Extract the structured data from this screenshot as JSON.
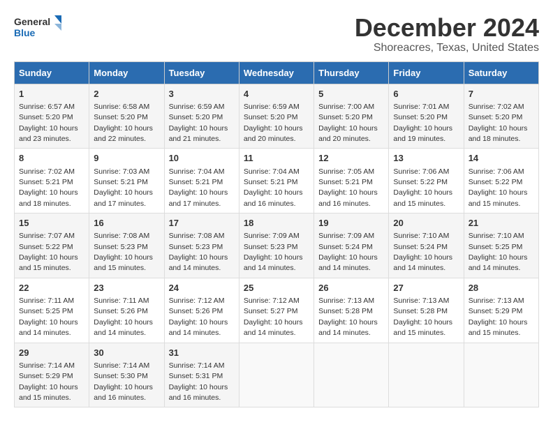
{
  "header": {
    "logo_line1": "General",
    "logo_line2": "Blue",
    "month": "December 2024",
    "location": "Shoreacres, Texas, United States"
  },
  "weekdays": [
    "Sunday",
    "Monday",
    "Tuesday",
    "Wednesday",
    "Thursday",
    "Friday",
    "Saturday"
  ],
  "weeks": [
    [
      {
        "day": "1",
        "info": "Sunrise: 6:57 AM\nSunset: 5:20 PM\nDaylight: 10 hours\nand 23 minutes."
      },
      {
        "day": "2",
        "info": "Sunrise: 6:58 AM\nSunset: 5:20 PM\nDaylight: 10 hours\nand 22 minutes."
      },
      {
        "day": "3",
        "info": "Sunrise: 6:59 AM\nSunset: 5:20 PM\nDaylight: 10 hours\nand 21 minutes."
      },
      {
        "day": "4",
        "info": "Sunrise: 6:59 AM\nSunset: 5:20 PM\nDaylight: 10 hours\nand 20 minutes."
      },
      {
        "day": "5",
        "info": "Sunrise: 7:00 AM\nSunset: 5:20 PM\nDaylight: 10 hours\nand 20 minutes."
      },
      {
        "day": "6",
        "info": "Sunrise: 7:01 AM\nSunset: 5:20 PM\nDaylight: 10 hours\nand 19 minutes."
      },
      {
        "day": "7",
        "info": "Sunrise: 7:02 AM\nSunset: 5:20 PM\nDaylight: 10 hours\nand 18 minutes."
      }
    ],
    [
      {
        "day": "8",
        "info": "Sunrise: 7:02 AM\nSunset: 5:21 PM\nDaylight: 10 hours\nand 18 minutes."
      },
      {
        "day": "9",
        "info": "Sunrise: 7:03 AM\nSunset: 5:21 PM\nDaylight: 10 hours\nand 17 minutes."
      },
      {
        "day": "10",
        "info": "Sunrise: 7:04 AM\nSunset: 5:21 PM\nDaylight: 10 hours\nand 17 minutes."
      },
      {
        "day": "11",
        "info": "Sunrise: 7:04 AM\nSunset: 5:21 PM\nDaylight: 10 hours\nand 16 minutes."
      },
      {
        "day": "12",
        "info": "Sunrise: 7:05 AM\nSunset: 5:21 PM\nDaylight: 10 hours\nand 16 minutes."
      },
      {
        "day": "13",
        "info": "Sunrise: 7:06 AM\nSunset: 5:22 PM\nDaylight: 10 hours\nand 15 minutes."
      },
      {
        "day": "14",
        "info": "Sunrise: 7:06 AM\nSunset: 5:22 PM\nDaylight: 10 hours\nand 15 minutes."
      }
    ],
    [
      {
        "day": "15",
        "info": "Sunrise: 7:07 AM\nSunset: 5:22 PM\nDaylight: 10 hours\nand 15 minutes."
      },
      {
        "day": "16",
        "info": "Sunrise: 7:08 AM\nSunset: 5:23 PM\nDaylight: 10 hours\nand 15 minutes."
      },
      {
        "day": "17",
        "info": "Sunrise: 7:08 AM\nSunset: 5:23 PM\nDaylight: 10 hours\nand 14 minutes."
      },
      {
        "day": "18",
        "info": "Sunrise: 7:09 AM\nSunset: 5:23 PM\nDaylight: 10 hours\nand 14 minutes."
      },
      {
        "day": "19",
        "info": "Sunrise: 7:09 AM\nSunset: 5:24 PM\nDaylight: 10 hours\nand 14 minutes."
      },
      {
        "day": "20",
        "info": "Sunrise: 7:10 AM\nSunset: 5:24 PM\nDaylight: 10 hours\nand 14 minutes."
      },
      {
        "day": "21",
        "info": "Sunrise: 7:10 AM\nSunset: 5:25 PM\nDaylight: 10 hours\nand 14 minutes."
      }
    ],
    [
      {
        "day": "22",
        "info": "Sunrise: 7:11 AM\nSunset: 5:25 PM\nDaylight: 10 hours\nand 14 minutes."
      },
      {
        "day": "23",
        "info": "Sunrise: 7:11 AM\nSunset: 5:26 PM\nDaylight: 10 hours\nand 14 minutes."
      },
      {
        "day": "24",
        "info": "Sunrise: 7:12 AM\nSunset: 5:26 PM\nDaylight: 10 hours\nand 14 minutes."
      },
      {
        "day": "25",
        "info": "Sunrise: 7:12 AM\nSunset: 5:27 PM\nDaylight: 10 hours\nand 14 minutes."
      },
      {
        "day": "26",
        "info": "Sunrise: 7:13 AM\nSunset: 5:28 PM\nDaylight: 10 hours\nand 14 minutes."
      },
      {
        "day": "27",
        "info": "Sunrise: 7:13 AM\nSunset: 5:28 PM\nDaylight: 10 hours\nand 15 minutes."
      },
      {
        "day": "28",
        "info": "Sunrise: 7:13 AM\nSunset: 5:29 PM\nDaylight: 10 hours\nand 15 minutes."
      }
    ],
    [
      {
        "day": "29",
        "info": "Sunrise: 7:14 AM\nSunset: 5:29 PM\nDaylight: 10 hours\nand 15 minutes."
      },
      {
        "day": "30",
        "info": "Sunrise: 7:14 AM\nSunset: 5:30 PM\nDaylight: 10 hours\nand 16 minutes."
      },
      {
        "day": "31",
        "info": "Sunrise: 7:14 AM\nSunset: 5:31 PM\nDaylight: 10 hours\nand 16 minutes."
      },
      {
        "day": "",
        "info": ""
      },
      {
        "day": "",
        "info": ""
      },
      {
        "day": "",
        "info": ""
      },
      {
        "day": "",
        "info": ""
      }
    ]
  ]
}
